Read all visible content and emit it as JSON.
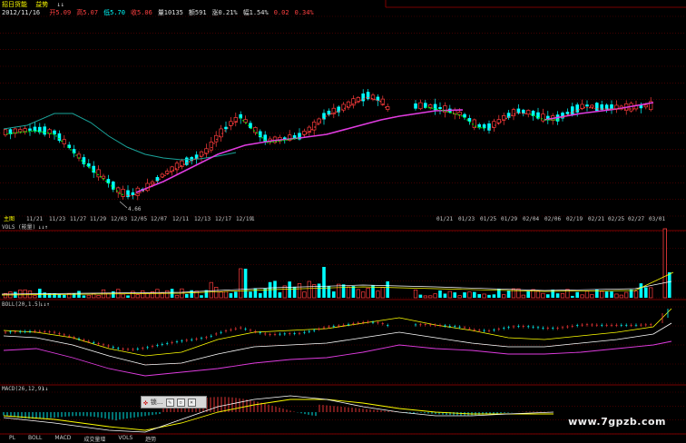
{
  "title": {
    "main": "招日货能",
    "sub": "益势",
    "arrows": "↓↓"
  },
  "header_quote": {
    "date": "2012/11/16",
    "items": [
      {
        "label": "开",
        "value": "5.09",
        "color": "#ff4040"
      },
      {
        "label": "高",
        "value": "5.07",
        "color": "#ff4040"
      },
      {
        "label": "低",
        "value": "5.70",
        "color": "#00ffff"
      },
      {
        "label": "收",
        "value": "5.06",
        "color": "#ff4040"
      },
      {
        "label": "量",
        "value": "10135",
        "color": "#e0e0e0"
      },
      {
        "label": "额",
        "value": "591",
        "color": "#e0e0e0"
      },
      {
        "label": "涨",
        "value": "0.21%",
        "color": "#e0e0e0"
      },
      {
        "label": "幅",
        "value": "1.54%",
        "color": "#e0e0e0"
      },
      {
        "label": "",
        "value": "0.02",
        "color": "#ff4040"
      },
      {
        "label": "",
        "value": "0.34%",
        "color": "#ff4040"
      }
    ]
  },
  "price_panel": {
    "low_marker": "4.66"
  },
  "date_axis_left": [
    "主图",
    "11/21",
    "11/23",
    "11/27",
    "11/29",
    "12/03",
    "12/05",
    "12/07",
    "12/11",
    "12/13",
    "12/17",
    "12/19",
    "1"
  ],
  "date_axis_right": [
    "01/21",
    "01/23",
    "01/25",
    "01/29",
    "02/04",
    "02/06",
    "02/19",
    "02/21",
    "02/25",
    "02/27",
    "03/01"
  ],
  "vol_header": "VOLS (能量)",
  "vol_arrows": "↓↓↑",
  "boll_header": "BOLL(20,1.5)",
  "boll_arrows": "↓↓↑",
  "macd_header": "MACD(26,12,9)",
  "macd_arrows": "↓↓",
  "popup": {
    "label": "锁..."
  },
  "watermark": "www.7gpzb.com",
  "bottom_tabs": [
    "PL",
    "BOLL",
    "MACD",
    "成交量增",
    "VOLS",
    "趋势"
  ]
}
